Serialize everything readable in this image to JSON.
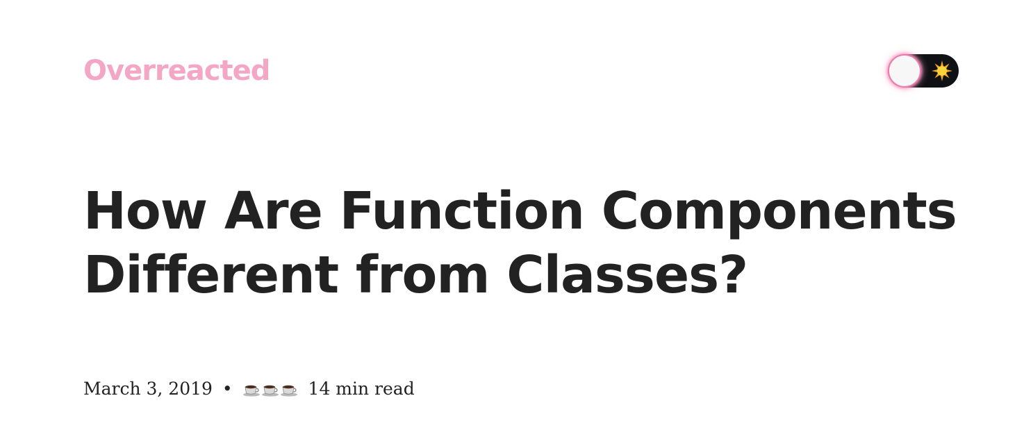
{
  "header": {
    "site_title": "Overreacted",
    "theme_toggle": {
      "state": "light",
      "icon": "sun-icon",
      "accent_color": "#ffa7c4"
    }
  },
  "post": {
    "title": "How Are Function Components Different from Classes?",
    "date": "March 3, 2019",
    "separator": "•",
    "reading_icon": "coffee-cup-icon",
    "reading_cups": 3,
    "read_time": "14 min read"
  },
  "colors": {
    "brand": "#f4a7c4",
    "text": "#222222",
    "toggle_bg": "#0f1114",
    "background": "#ffffff"
  }
}
